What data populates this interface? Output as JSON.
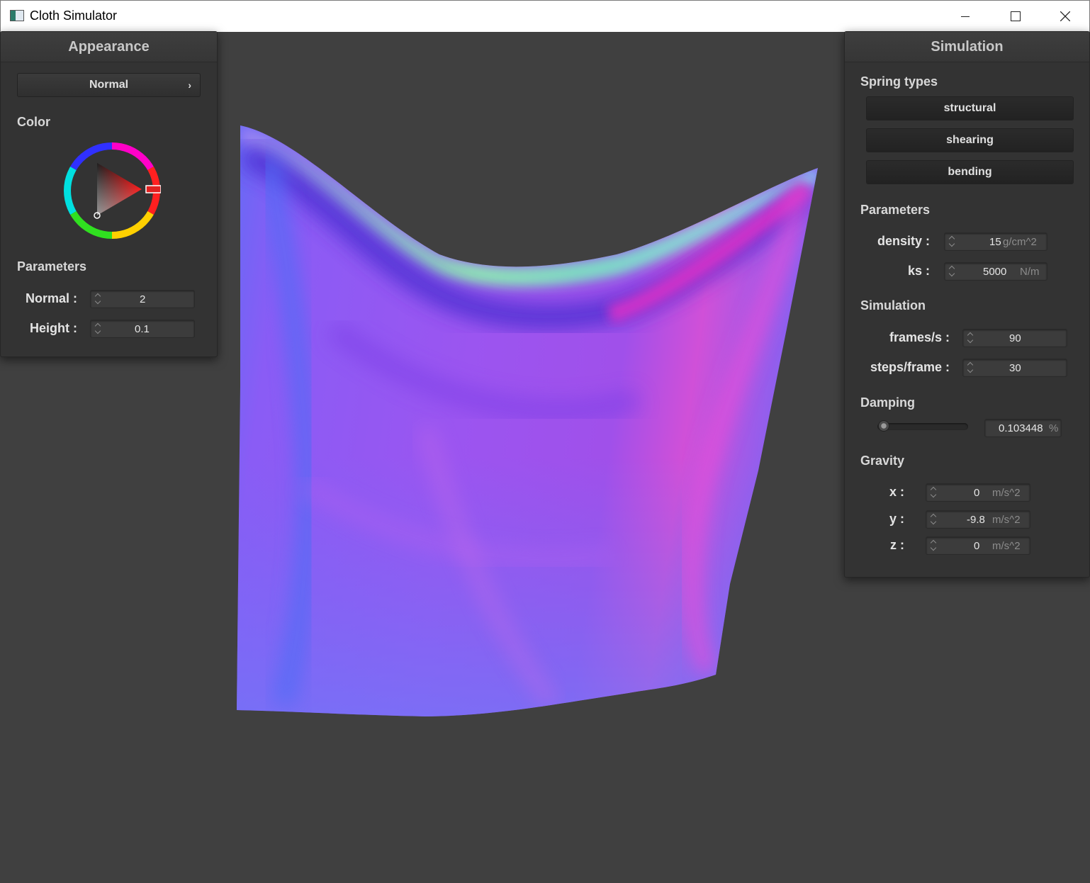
{
  "window": {
    "title": "Cloth Simulator"
  },
  "appearance": {
    "title": "Appearance",
    "shader_selector": "Normal",
    "color_label": "Color",
    "parameters_label": "Parameters",
    "normal_label": "Normal :",
    "normal_value": "2",
    "height_label": "Height :",
    "height_value": "0.1",
    "selected_color": "#ff0000"
  },
  "simulation": {
    "title": "Simulation",
    "spring_types_label": "Spring types",
    "spring_types": [
      "structural",
      "shearing",
      "bending"
    ],
    "parameters_label": "Parameters",
    "density_label": "density :",
    "density_value": "15",
    "density_unit": "g/cm^2",
    "ks_label": "ks :",
    "ks_value": "5000",
    "ks_unit": "N/m",
    "simulation_label": "Simulation",
    "fps_label": "frames/s :",
    "fps_value": "90",
    "steps_label": "steps/frame :",
    "steps_value": "30",
    "damping_label": "Damping",
    "damping_value": "0.103448",
    "damping_unit": "%",
    "damping_fraction": 0.01,
    "gravity_label": "Gravity",
    "gravity": [
      {
        "label": "x :",
        "value": "0",
        "unit": "m/s^2"
      },
      {
        "label": "y :",
        "value": "-9.8",
        "unit": "m/s^2"
      },
      {
        "label": "z :",
        "value": "0",
        "unit": "m/s^2"
      }
    ]
  },
  "colors": {
    "background": "#404040",
    "panel": "#333333",
    "cloth_main": "#8a5cf2",
    "cloth_highlight": "#e040d0",
    "cloth_fold": "#5a3fe0",
    "cloth_top": "#7fe8b0"
  }
}
